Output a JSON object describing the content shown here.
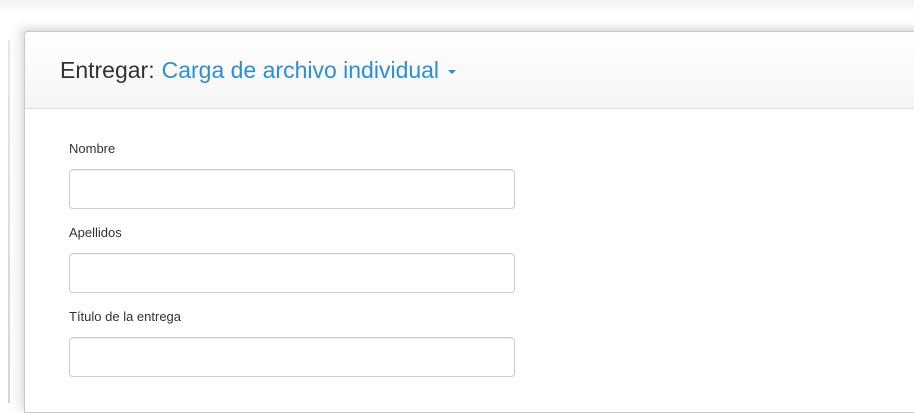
{
  "header": {
    "prefix": "Entregar:",
    "dropdown_label": "Carga de archivo individual"
  },
  "form": {
    "fields": [
      {
        "label": "Nombre",
        "value": "",
        "placeholder": ""
      },
      {
        "label": "Apellidos",
        "value": "",
        "placeholder": ""
      },
      {
        "label": "Título de la entrega",
        "value": "",
        "placeholder": ""
      }
    ]
  },
  "colors": {
    "accent": "#2a8fd8",
    "header_text": "#333333",
    "border": "#cccccc"
  },
  "icons": {
    "dropdown": "caret-down-icon"
  }
}
